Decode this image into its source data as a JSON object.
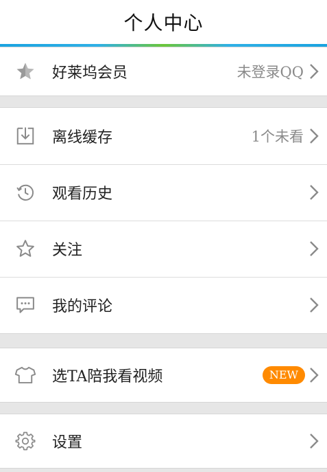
{
  "header": {
    "title": "个人中心"
  },
  "group1": {
    "items": [
      {
        "label": "好莱坞会员",
        "value": "未登录QQ",
        "icon": "star-filled-icon"
      }
    ]
  },
  "group2": {
    "items": [
      {
        "label": "离线缓存",
        "value": "1个未看",
        "icon": "download-icon"
      },
      {
        "label": "观看历史",
        "value": "",
        "icon": "history-icon"
      },
      {
        "label": "关注",
        "value": "",
        "icon": "star-outline-icon"
      },
      {
        "label": "我的评论",
        "value": "",
        "icon": "comment-icon"
      }
    ]
  },
  "group3": {
    "items": [
      {
        "label": "选TA陪我看视频",
        "badge": "NEW",
        "icon": "shirt-icon"
      }
    ]
  },
  "group4": {
    "items": [
      {
        "label": "设置",
        "value": "",
        "icon": "gear-icon"
      }
    ]
  },
  "colors": {
    "accent": "#1aa3e0",
    "badge": "#ff8a00",
    "background": "#e6e6e6"
  }
}
